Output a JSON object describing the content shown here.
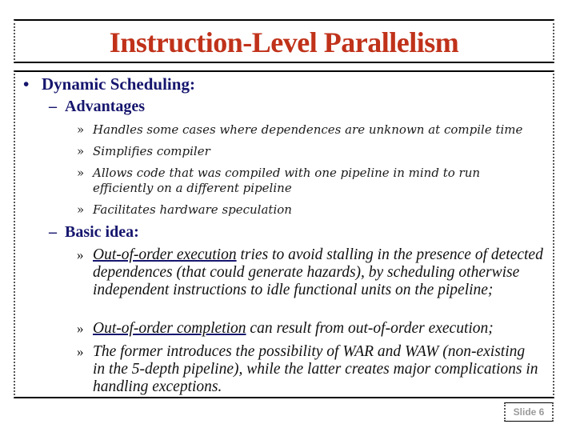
{
  "slide": {
    "title": "Instruction-Level Parallelism",
    "slide_number": "Slide 6",
    "colors": {
      "title": "#c0321a",
      "heading": "#16166e",
      "body": "#1a1a1a",
      "slide_number": "#9a9a9a"
    }
  },
  "content": {
    "level1": {
      "bullet": "•",
      "text": "Dynamic Scheduling:"
    },
    "advantages": {
      "dash": "–",
      "heading": "Advantages",
      "items": [
        {
          "mark": "»",
          "text": "Handles some cases where dependences are unknown at compile time"
        },
        {
          "mark": "»",
          "text": "Simplifies compiler"
        },
        {
          "mark": "»",
          "text": "Allows code that was compiled with one pipeline in mind to run efficiently on a different pipeline"
        },
        {
          "mark": "»",
          "text": "Facilitates hardware speculation"
        }
      ]
    },
    "basic_idea": {
      "dash": "–",
      "heading": "Basic idea:",
      "items": [
        {
          "mark": "»",
          "underlined": "Out-of-order execution",
          "text": " tries to avoid stalling in the presence of detected dependences (that could generate hazards), by scheduling otherwise independent instructions to idle functional units on the pipeline;"
        },
        {
          "mark": "»",
          "underlined": "Out-of-order completion",
          "text": " can result from out-of-order execution;"
        },
        {
          "mark": "»",
          "underlined": "",
          "text": "The former introduces the possibility of WAR and WAW (non-existing in the 5-depth pipeline), while the latter creates major complications in handling exceptions."
        }
      ]
    }
  }
}
